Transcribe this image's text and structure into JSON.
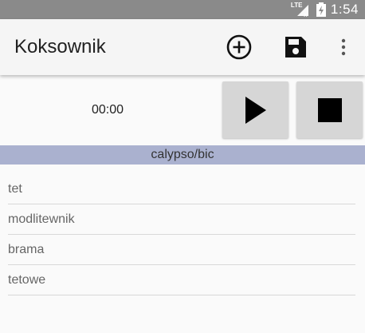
{
  "status_bar": {
    "network": "LTE",
    "time": "1:54"
  },
  "app_bar": {
    "title": "Koksownik",
    "actions": [
      "add-circle-icon",
      "save-icon",
      "more-vert-icon"
    ]
  },
  "player": {
    "elapsed": "00:00",
    "play_icon": "play-icon",
    "stop_icon": "stop-icon"
  },
  "station": {
    "name": "calypso/bic"
  },
  "list": {
    "items": [
      "tet",
      "modlitewnik",
      "brama",
      "tetowe"
    ]
  },
  "colors": {
    "status_bar": "#8a8a8a",
    "app_bar": "#f5f5f5",
    "station_bar": "#aab1cf",
    "button_bg": "#d6d6d6"
  }
}
